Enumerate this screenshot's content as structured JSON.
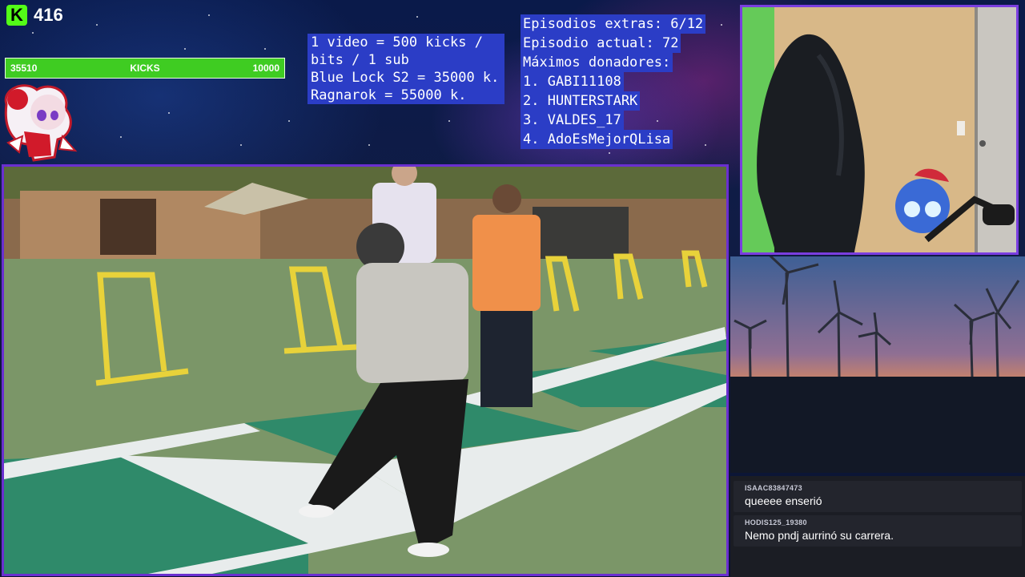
{
  "kick_counter": {
    "logo": "K",
    "count": "416"
  },
  "goal_bar": {
    "current": "35510",
    "label": "KICKS",
    "target": "10000",
    "fill_fraction": 1.0
  },
  "info_left": {
    "lines": [
      "1 video = 500 kicks /",
      "bits / 1 sub",
      "Blue Lock S2 = 35000 k.",
      "Ragnarok = 55000 k."
    ]
  },
  "info_right": {
    "lines": [
      "Episodios extras: 6/12",
      "Episodio actual: 72",
      "Máximos donadores:",
      "1. GABI11108",
      "2. HUNTERSTARK",
      "3. VALDES_17",
      "4. AdoEsMejorQLisa"
    ]
  },
  "chat": {
    "messages": [
      {
        "user": "ISAAC83847473",
        "text": "queeee enserió"
      },
      {
        "user": "HODIS125_19380",
        "text": "Nemo pndj aurrinó su carrera."
      }
    ]
  },
  "colors": {
    "accent_purple": "#6a2fd0",
    "kick_green": "#53fc18",
    "panel_blue": "#2b3dc6"
  }
}
